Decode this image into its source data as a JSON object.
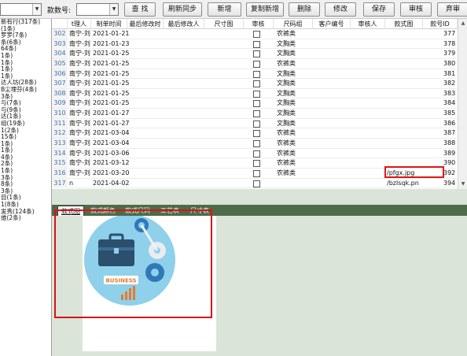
{
  "toolbar": {
    "style_no_label": "款数号:",
    "style_no_value": "",
    "search_button": "查 找",
    "buttons": [
      "刷新同步",
      "新增",
      "复制新增",
      "删除",
      "修改",
      "保存",
      "审核",
      "弃审"
    ]
  },
  "left_panel": {
    "items": [
      "新有行(317条)",
      "(1条)",
      "罗罗(7条)",
      "条(6条)",
      "64条)",
      "1条)",
      "1条)",
      "1条)",
      "1条)",
      "达人坊(28条)",
      "B尘埋芬(4条)",
      "3条)",
      "与(7条)",
      "与(9条)",
      "达(1条)",
      "组(19条)",
      "1(2条)",
      "15条)",
      "1条)",
      "1条)",
      "4条)",
      "2条)",
      "1条)",
      "3条)",
      "8条)",
      "3条)",
      "目(1条)",
      "1(8条)",
      "发秀(124条)",
      "维(2条)"
    ]
  },
  "grid": {
    "columns": [
      "t理人",
      "制单时间",
      "最后修改时",
      "最后修改人",
      "尺寸图",
      "审核",
      "尺码组",
      "客户编号",
      "审核人",
      "款式图",
      "款号ID"
    ],
    "rows": [
      {
        "num": "302",
        "agent": "南宁-刘",
        "date": "2021-01-21",
        "group": "农裤类",
        "image": "",
        "id": "377"
      },
      {
        "num": "303",
        "agent": "南宁-刘",
        "date": "2021-01-23",
        "group": "文胸类",
        "image": "",
        "id": "378"
      },
      {
        "num": "304",
        "agent": "南宁-刘",
        "date": "2021-01-25",
        "group": "文胸类",
        "image": "",
        "id": "379"
      },
      {
        "num": "305",
        "agent": "南宁-刘",
        "date": "2021-01-25",
        "group": "农裤类",
        "image": "",
        "id": "380"
      },
      {
        "num": "306",
        "agent": "南宁-刘",
        "date": "2021-01-25",
        "group": "文胸类",
        "image": "",
        "id": "381"
      },
      {
        "num": "307",
        "agent": "南宁-刘",
        "date": "2021-01-25",
        "group": "文胸类",
        "image": "",
        "id": "382"
      },
      {
        "num": "308",
        "agent": "南宁-刘",
        "date": "2021-01-25",
        "group": "文胸类",
        "image": "",
        "id": "383"
      },
      {
        "num": "309",
        "agent": "南宁-刘",
        "date": "2021-01-25",
        "group": "文胸类",
        "image": "",
        "id": "384"
      },
      {
        "num": "310",
        "agent": "南宁-刘",
        "date": "2021-01-27",
        "group": "文胸类",
        "image": "",
        "id": "385"
      },
      {
        "num": "311",
        "agent": "南宁-刘",
        "date": "2021-01-27",
        "group": "文胸类",
        "image": "",
        "id": "386"
      },
      {
        "num": "312",
        "agent": "南宁-刘",
        "date": "2021-03-04",
        "group": "农裤类",
        "image": "",
        "id": "387"
      },
      {
        "num": "313",
        "agent": "南宁-刘",
        "date": "2021-03-04",
        "group": "农裤类",
        "image": "",
        "id": "388"
      },
      {
        "num": "314",
        "agent": "南宁-刘",
        "date": "2021-03-06",
        "group": "农裤类",
        "image": "",
        "id": "389"
      },
      {
        "num": "315",
        "agent": "南宁-刘",
        "date": "2021-03-12",
        "group": "农裤类",
        "image": "",
        "id": "390"
      },
      {
        "num": "316",
        "agent": "南宁-刘",
        "date": "2021-03-20",
        "group": "农裤类",
        "image": "/pfgx.jpg",
        "id": "392"
      },
      {
        "num": "317",
        "agent": "n",
        "date": "2021-04-02",
        "group": "",
        "image": "/bzlsqk.pn",
        "id": "394"
      }
    ]
  },
  "lower": {
    "tabs": [
      "款式图",
      "款式颜色",
      "款式尺码",
      "工艺表",
      "尺寸表"
    ],
    "active_tab_index": 0,
    "image_text": "BUSINESS"
  },
  "colors": {
    "tab_bar": "#4d6b48",
    "lower_bg": "#dbe4d8",
    "highlight": "#e01818",
    "row_number": "#3a6ea8"
  }
}
